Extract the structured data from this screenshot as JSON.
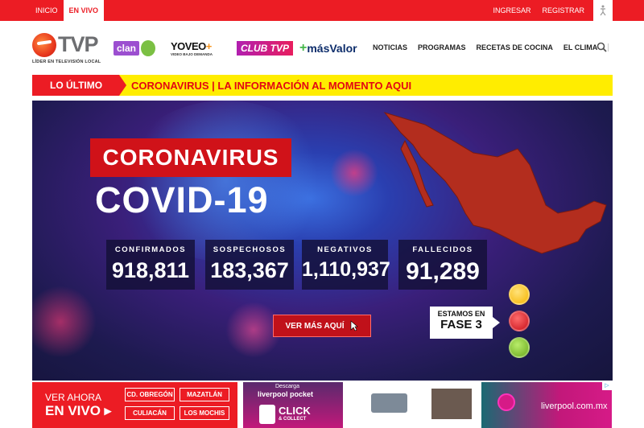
{
  "topbar": {
    "left_links": [
      "INICIO",
      "EN VIVO"
    ],
    "right_links": [
      "INGRESAR",
      "REGISTRAR"
    ]
  },
  "header": {
    "logo_text": "TVP",
    "logo_tagline": "LÍDER EN TELEVISIÓN LOCAL",
    "brands": {
      "clan": "clan",
      "yoveo": "YOVEO",
      "yoveo_plus": "+",
      "yoveo_sub": "VIDEO BAJO DEMANDA",
      "club": "CLUB TVP",
      "mas_plus": "+",
      "mas_text": "másValor"
    },
    "nav": [
      "NOTICIAS",
      "PROGRAMAS",
      "RECETAS DE COCINA",
      "EL CLIMA"
    ]
  },
  "ticker": {
    "label": "LO ÚLTIMO",
    "text": "CORONAVIRUS | LA INFORMACIÓN AL MOMENTO AQUI"
  },
  "banner": {
    "coronavirus": "CORONAVIRUS",
    "covid": "COVID-19",
    "stats": [
      {
        "label": "CONFIRMADOS",
        "value": "918,811"
      },
      {
        "label": "SOSPECHOSOS",
        "value": "183,367"
      },
      {
        "label": "NEGATIVOS",
        "value": "1,110,937"
      },
      {
        "label": "FALLECIDOS",
        "value": "91,289"
      }
    ],
    "button": "VER MÁS AQUÍ",
    "fase_top": "ESTAMOS EN",
    "fase_bottom": "FASE 3"
  },
  "live": {
    "line1": "VER AHORA",
    "line2": "EN VIVO ▸",
    "cities": [
      "CD. OBREGÓN",
      "MAZATLÁN",
      "CULIACÁN",
      "LOS MOCHIS"
    ]
  },
  "ads": {
    "ad1_top": "Descarga",
    "ad1_brand": "liverpool pocket",
    "ad1_cta": "CLICK",
    "ad1_cta2": "& COLLECT",
    "ad3_brand": "liverpool.com.mx"
  },
  "colors": {
    "brand_red": "#ec1c24",
    "ticker_yellow": "#ffed00",
    "banner_dark": "#1d1a4f"
  }
}
